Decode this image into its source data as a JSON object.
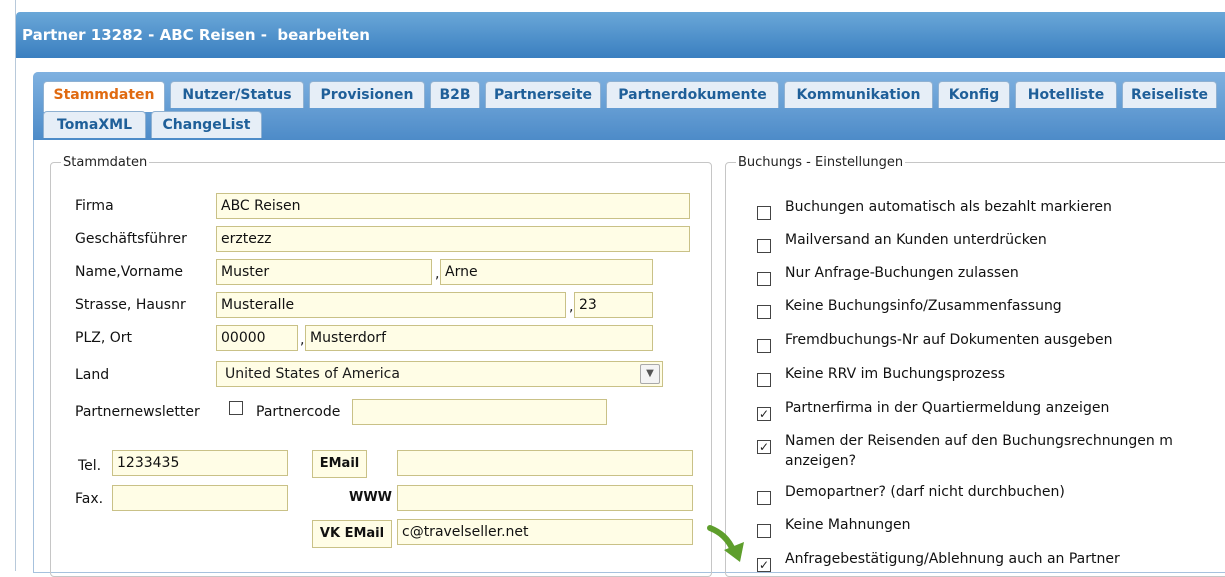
{
  "window": {
    "title": "Partner 13282 - ABC Reisen -  bearbeiten"
  },
  "tabs": [
    {
      "label": "Stammdaten",
      "active": true
    },
    {
      "label": "Nutzer/Status"
    },
    {
      "label": "Provisionen"
    },
    {
      "label": "B2B"
    },
    {
      "label": "Partnerseite"
    },
    {
      "label": "Partnerdokumente"
    },
    {
      "label": "Kommunikation"
    },
    {
      "label": "Konfig"
    },
    {
      "label": "Hotelliste"
    },
    {
      "label": "Reiseliste"
    },
    {
      "label": "TomaXML"
    },
    {
      "label": "ChangeList"
    }
  ],
  "stammdaten": {
    "legend": "Stammdaten",
    "firma_label": "Firma",
    "firma": "ABC Reisen",
    "gf_label": "Geschäftsführer",
    "gf": "erztezz",
    "name_label": "Name,Vorname",
    "name": "Muster",
    "vorname": "Arne",
    "strasse_label": "Strasse, Hausnr",
    "strasse": "Musteralle",
    "hausnr": "23",
    "plz_label": "PLZ, Ort",
    "plz": "00000",
    "ort": "Musterdorf",
    "land_label": "Land",
    "land": "United States of America",
    "newsletter_label": "Partnernewsletter",
    "newsletter_checked": false,
    "partnercode_label": "Partnercode",
    "partnercode": "",
    "tel_label": "Tel.",
    "tel": "1233435",
    "fax_label": "Fax.",
    "fax": "",
    "email_button": "EMail",
    "email": "",
    "www_label": "WWW",
    "www": "",
    "vkemail_button": "VK EMail",
    "vkemail": "c@travelseller.net",
    "comma": ","
  },
  "buchung": {
    "legend": "Buchungs - Einstellungen",
    "options": [
      {
        "label": "Buchungen automatisch als bezahlt markieren",
        "checked": false
      },
      {
        "label": "Mailversand an Kunden unterdrücken",
        "checked": false
      },
      {
        "label": "Nur Anfrage-Buchungen zulassen",
        "checked": false
      },
      {
        "label": "Keine Buchungsinfo/Zusammenfassung",
        "checked": false
      },
      {
        "label": "Fremdbuchungs-Nr auf Dokumenten ausgeben",
        "checked": false
      },
      {
        "label": "Keine RRV im Buchungsprozess",
        "checked": false
      },
      {
        "label": "Partnerfirma in der Quartiermeldung anzeigen",
        "checked": true
      },
      {
        "label": "Namen der Reisenden auf den Buchungsrechnungen m",
        "label2": "anzeigen?",
        "checked": true
      },
      {
        "label": "Demopartner? (darf nicht durchbuchen)",
        "checked": false
      },
      {
        "label": "Keine Mahnungen",
        "checked": false
      },
      {
        "label": "Anfragebestätigung/Ablehnung auch an Partner",
        "checked": true
      }
    ],
    "check_mark": "✓"
  },
  "colors": {
    "title_bar": "#4a8cc9",
    "active_tab": "#e06a10",
    "arrow": "#5e9e2c"
  }
}
